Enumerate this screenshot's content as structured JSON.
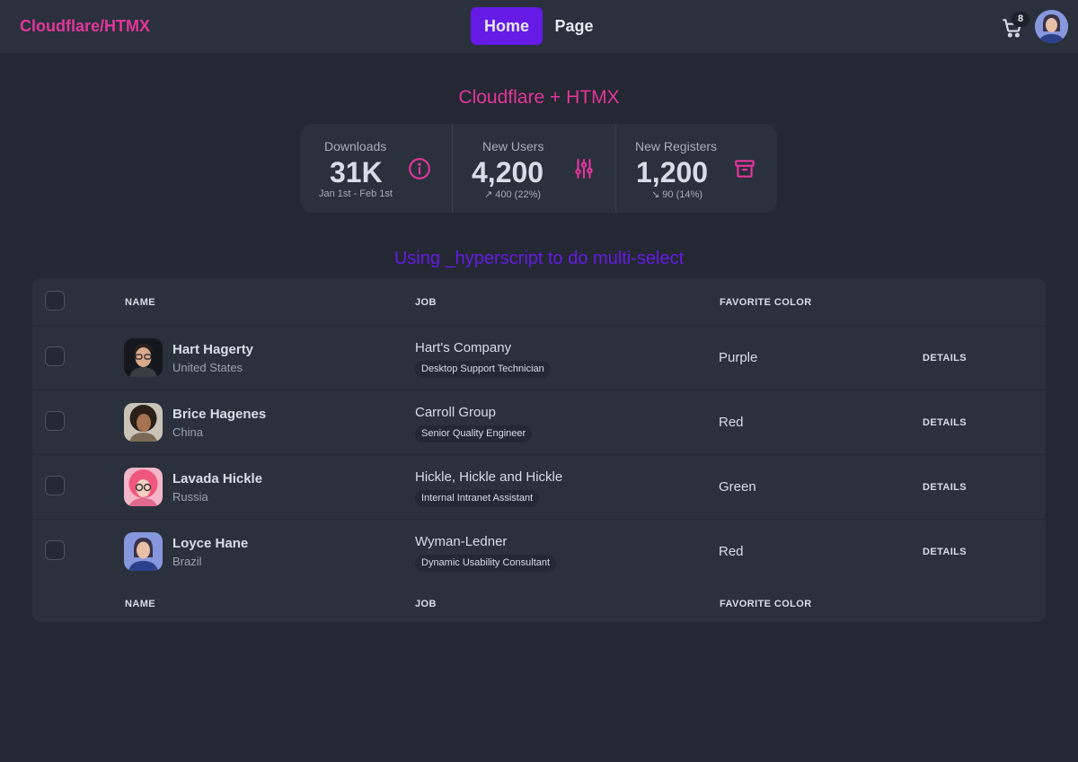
{
  "navbar": {
    "brand": "Cloudflare/HTMX",
    "links": [
      {
        "label": "Home",
        "active": true
      },
      {
        "label": "Page",
        "active": false
      }
    ],
    "cart_count": "8"
  },
  "headings": {
    "main": "Cloudflare + HTMX",
    "table": "Using _hyperscript to do multi-select"
  },
  "stats": [
    {
      "title": "Downloads",
      "value": "31K",
      "desc": "Jan 1st - Feb 1st",
      "icon": "info-circle-icon"
    },
    {
      "title": "New Users",
      "value": "4,200",
      "desc": "↗︎ 400 (22%)",
      "icon": "sliders-icon"
    },
    {
      "title": "New Registers",
      "value": "1,200",
      "desc": "↘︎ 90 (14%)",
      "icon": "archive-box-icon"
    }
  ],
  "table": {
    "headers": [
      "NAME",
      "JOB",
      "FAVORITE COLOR"
    ],
    "footers": [
      "NAME",
      "JOB",
      "FAVORITE COLOR"
    ],
    "details_label": "DETAILS",
    "rows": [
      {
        "name": "Hart Hagerty",
        "country": "United States",
        "company": "Hart's Company",
        "job": "Desktop Support Technician",
        "color": "Purple"
      },
      {
        "name": "Brice Hagenes",
        "country": "China",
        "company": "Carroll Group",
        "job": "Senior Quality Engineer",
        "color": "Red"
      },
      {
        "name": "Lavada Hickle",
        "country": "Russia",
        "company": "Hickle, Hickle and Hickle",
        "job": "Internal Intranet Assistant",
        "color": "Green"
      },
      {
        "name": "Loyce Hane",
        "country": "Brazil",
        "company": "Wyman-Ledner",
        "job": "Dynamic Usability Consultant",
        "color": "Red"
      }
    ]
  },
  "colors": {
    "primary": "#661ae6",
    "secondary": "#e3359b",
    "base": "#2a303c",
    "background": "#232832"
  }
}
